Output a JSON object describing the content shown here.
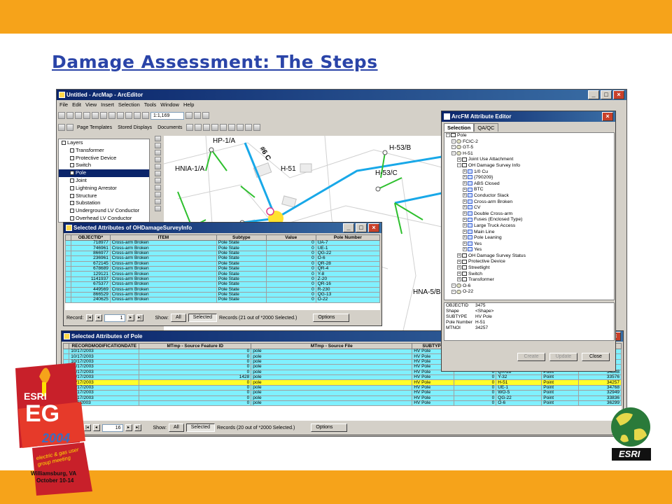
{
  "slide": {
    "title": "Damage Assessment: The Steps"
  },
  "arcmap": {
    "title": "Untitled - ArcMap - ArcEditor",
    "menu": [
      "File",
      "Edit",
      "View",
      "Insert",
      "Selection",
      "Tools",
      "Window",
      "Help"
    ],
    "scale": "1:1,169",
    "page_templates": "Page Templates",
    "stored_displays": "Stored Displays",
    "documents": "Documents",
    "toc_items": [
      "Layers",
      "Transformer",
      "Protective Device",
      "Switch",
      "Pole",
      "Joint",
      "Lightning Arrestor",
      "Structure",
      "Substation",
      "Underground LV Conductor",
      "Overhead LV Conductor"
    ],
    "map_labels": [
      "HP-1/A",
      "#6 C",
      "HNIA-1/A",
      "H-51",
      "H-53/B",
      "H-53/C",
      "HNA-5/B"
    ]
  },
  "survey_window": {
    "title": "Selected Attributes of OHDamageSurveyInfo",
    "columns": [
      "OBJECTID*",
      "ITEM",
      "Subtype",
      "Value",
      "Pole Number"
    ],
    "rows": [
      [
        "718977",
        "Cross-arm Broken",
        "Pole State",
        "0",
        "UA-7"
      ],
      [
        "746961",
        "Cross-arm Broken",
        "Pole State",
        "0",
        "UE-1"
      ],
      [
        "866977",
        "Cross-arm Broken",
        "Pole State",
        "0",
        "QG-22"
      ],
      [
        "236961",
        "Cross-arm Broken",
        "Pole State",
        "0",
        "O-6"
      ],
      [
        "672145",
        "Cross-arm Broken",
        "Pole State",
        "0",
        "QR-28"
      ],
      [
        "678689",
        "Cross-arm Broken",
        "Pole State",
        "0",
        "QR-4"
      ],
      [
        "129121",
        "Cross-arm Broken",
        "Pole State",
        "0",
        "Y-8"
      ],
      [
        "1141937",
        "Cross-arm Broken",
        "Pole State",
        "0",
        "Z-20"
      ],
      [
        "675377",
        "Cross-arm Broken",
        "Pole State",
        "0",
        "QR-16"
      ],
      [
        "449569",
        "Cross-arm Broken",
        "Pole State",
        "0",
        "R-230"
      ],
      [
        "866529",
        "Cross-arm Broken",
        "Pole State",
        "0",
        "QG-13"
      ],
      [
        "240625",
        "Cross-arm Broken",
        "Pole State",
        "0",
        "O-22"
      ]
    ],
    "nav": {
      "record_label": "Record:",
      "record_value": "1",
      "show_label": "Show:",
      "all": "All",
      "selected": "Selected",
      "records_text": "Records  (21 out of *2000 Selected.)",
      "options": "Options"
    }
  },
  "pole_window": {
    "title": "Selected Attributes of Pole",
    "columns": [
      "RECORDMODIFICATIONDATE",
      "MTmp - Source Feature ID",
      "MTmp - Source File",
      "SUBTYPE",
      "Sym"
    ],
    "rows": [
      [
        "10/17/2003",
        "0",
        "pole",
        "HV Pole",
        "",
        "",
        "",
        ""
      ],
      [
        "10/17/2003",
        "0",
        "pole",
        "HV Pole",
        "",
        "",
        "",
        ""
      ],
      [
        "10/17/2003",
        "0",
        "pole",
        "HV Pole",
        "",
        "",
        "",
        ""
      ],
      [
        "10/17/2003",
        "0",
        "pole",
        "HV Pole",
        "",
        "",
        "",
        ""
      ],
      [
        "10/17/2003",
        "0",
        "pole",
        "HV Pole",
        "0",
        "QR-28",
        "Point",
        "34808"
      ],
      [
        "10/17/2003",
        "1428",
        "pole",
        "HV Pole",
        "0",
        "Y-32",
        "Point",
        "33576"
      ],
      [
        "10/17/2003",
        "0",
        "pole",
        "HV Pole",
        "0",
        "H-51",
        "Point",
        "34257"
      ],
      [
        "10/17/2003",
        "0",
        "pole",
        "HV Pole",
        "0",
        "UE-1",
        "Point",
        "34768"
      ],
      [
        "10/17/2003",
        "0",
        "pole",
        "HV Pole",
        "0",
        "WO-5",
        "Point",
        "32949"
      ],
      [
        "10/17/2003",
        "0",
        "pole",
        "HV Pole",
        "0",
        "QG-22",
        "Point",
        "33836"
      ],
      [
        "11/6/2003",
        "0",
        "pole",
        "HV Pole",
        "0",
        "O-6",
        "Point",
        "36299"
      ]
    ],
    "highlight_row": 6,
    "nav": {
      "record_label": "Record:",
      "record_value": "16",
      "show_label": "Show:",
      "all": "All",
      "selected": "Selected",
      "records_text": "Records  (20 out of *2000 Selected.)",
      "options": "Options"
    }
  },
  "editor": {
    "title": "ArcFM Attribute Editor",
    "tabs": [
      "Selection",
      "QA/QC"
    ],
    "tree": [
      {
        "t": "Pole",
        "lvl": 0,
        "ic": "ft"
      },
      {
        "t": "FCIC-2",
        "lvl": 1,
        "ic": "fi"
      },
      {
        "t": "GT-5",
        "lvl": 1,
        "ic": "fi"
      },
      {
        "t": "H-51",
        "lvl": 1,
        "ic": "fi"
      },
      {
        "t": "Joint Use Attachment",
        "lvl": 2,
        "ic": "ft"
      },
      {
        "t": "OH Damage Survey Info",
        "lvl": 2,
        "ic": "ft"
      },
      {
        "t": "1/0 Cu",
        "lvl": 3,
        "ic": "t"
      },
      {
        "t": "{790209}",
        "lvl": 3,
        "ic": "t"
      },
      {
        "t": "ABS Closed",
        "lvl": 3,
        "ic": "t"
      },
      {
        "t": "BTC",
        "lvl": 3,
        "ic": "t"
      },
      {
        "t": "Conductor Slack",
        "lvl": 3,
        "ic": "t"
      },
      {
        "t": "Cross-arm Broken",
        "lvl": 3,
        "ic": "t"
      },
      {
        "t": "CV",
        "lvl": 3,
        "ic": "t"
      },
      {
        "t": "Double Cross-arm",
        "lvl": 3,
        "ic": "t"
      },
      {
        "t": "Fuses (Enclosed Type)",
        "lvl": 3,
        "ic": "t"
      },
      {
        "t": "Large Truck Access",
        "lvl": 3,
        "ic": "t"
      },
      {
        "t": "Main Line",
        "lvl": 3,
        "ic": "t"
      },
      {
        "t": "Pole Leaning",
        "lvl": 3,
        "ic": "t"
      },
      {
        "t": "Yes",
        "lvl": 3,
        "ic": "t"
      },
      {
        "t": "Yes",
        "lvl": 3,
        "ic": "t"
      },
      {
        "t": "OH Damage Survey Status",
        "lvl": 2,
        "ic": "ft"
      },
      {
        "t": "Protective Device",
        "lvl": 2,
        "ic": "ft"
      },
      {
        "t": "Streetlight",
        "lvl": 2,
        "ic": "ft"
      },
      {
        "t": "Switch",
        "lvl": 2,
        "ic": "ft"
      },
      {
        "t": "Transformer",
        "lvl": 2,
        "ic": "ft"
      },
      {
        "t": "O-6",
        "lvl": 1,
        "ic": "fi"
      },
      {
        "t": "O-22",
        "lvl": 1,
        "ic": "fi"
      }
    ],
    "props": [
      [
        "OBJECTID",
        "3475"
      ],
      [
        "Shape",
        "<Shape>"
      ],
      [
        "SUBTYPE",
        "HV Pole"
      ],
      [
        "Pole Number",
        "H-51"
      ],
      [
        "MTNOI",
        "34257"
      ]
    ],
    "buttons": {
      "create": "Create",
      "update": "Update",
      "close": "Close"
    }
  },
  "logos": {
    "esri_eg": "ESRI",
    "eg": "EG",
    "year": "2004",
    "meeting": "electric & gas user group meeting",
    "location": "Williamsburg, VA",
    "dates": "October 10-14",
    "esri_right": "ESRI"
  }
}
